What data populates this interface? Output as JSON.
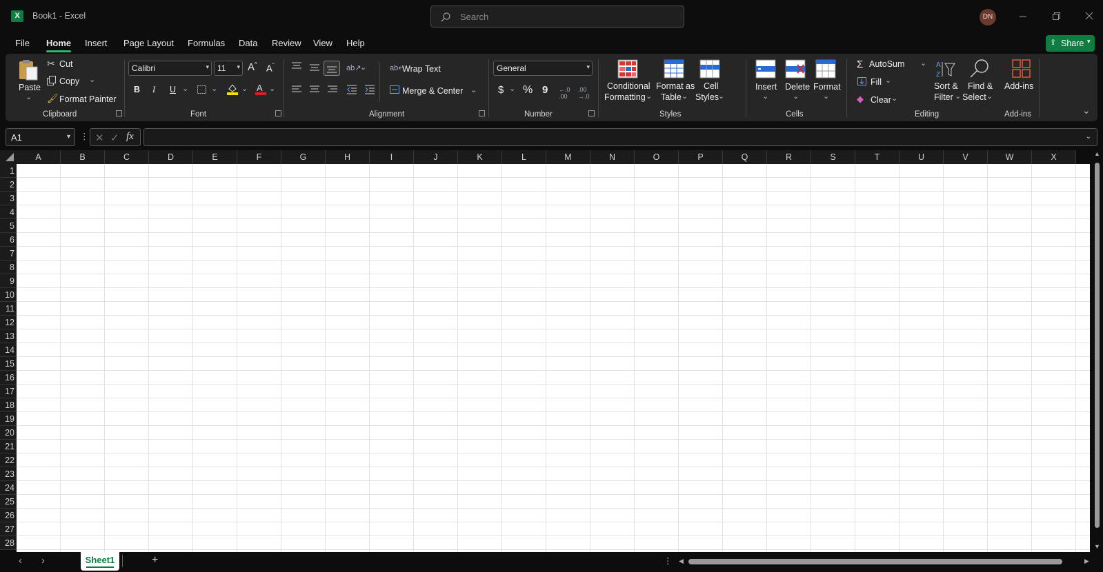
{
  "window": {
    "app_badge": "X",
    "title": "Book1  -  Excel",
    "search_placeholder": "Search",
    "avatar_initials": "DN"
  },
  "menu": {
    "tabs": [
      "File",
      "Home",
      "Insert",
      "Page Layout",
      "Formulas",
      "Data",
      "Review",
      "View",
      "Help"
    ],
    "active_tab": "Home",
    "share_label": "Share"
  },
  "ribbon": {
    "clipboard": {
      "paste": "Paste",
      "cut": "Cut",
      "copy": "Copy",
      "format_painter": "Format Painter",
      "group_label": "Clipboard"
    },
    "font": {
      "font_name": "Calibri",
      "font_size": "11",
      "bold": "B",
      "italic": "I",
      "underline": "U",
      "group_label": "Font"
    },
    "alignment": {
      "wrap_text": "Wrap Text",
      "merge_center": "Merge & Center",
      "group_label": "Alignment"
    },
    "number": {
      "format": "General",
      "currency": "$",
      "percent": "%",
      "comma": "9",
      "group_label": "Number"
    },
    "styles": {
      "conditional_1": "Conditional",
      "conditional_2": "Formatting",
      "format_table_1": "Format as",
      "format_table_2": "Table",
      "cell_styles_1": "Cell",
      "cell_styles_2": "Styles",
      "group_label": "Styles"
    },
    "cells": {
      "insert": "Insert",
      "delete": "Delete",
      "format": "Format",
      "group_label": "Cells"
    },
    "editing": {
      "autosum": "AutoSum",
      "fill": "Fill",
      "clear": "Clear",
      "sort_1": "Sort &",
      "sort_2": "Filter",
      "find_1": "Find &",
      "find_2": "Select",
      "group_label": "Editing"
    },
    "addins": {
      "label": "Add-ins",
      "group_label": "Add-ins"
    }
  },
  "formula_bar": {
    "name_box": "A1",
    "fx": "fx",
    "formula": ""
  },
  "grid": {
    "columns": [
      "A",
      "B",
      "C",
      "D",
      "E",
      "F",
      "G",
      "H",
      "I",
      "J",
      "K",
      "L",
      "M",
      "N",
      "O",
      "P",
      "Q",
      "R",
      "S",
      "T",
      "U",
      "V",
      "W",
      "X"
    ],
    "rows": [
      "1",
      "2",
      "3",
      "4",
      "5",
      "6",
      "7",
      "8",
      "9",
      "10",
      "11",
      "12",
      "13",
      "14",
      "15",
      "16",
      "17",
      "18",
      "19",
      "20",
      "21",
      "22",
      "23",
      "24",
      "25",
      "26",
      "27",
      "28"
    ]
  },
  "sheets": {
    "tabs": [
      "Sheet1"
    ],
    "active": "Sheet1"
  },
  "colors": {
    "accent": "#107c41",
    "active_tab_underline": "#2fb86f",
    "background": "#0d0d0d",
    "ribbon": "#262626"
  }
}
